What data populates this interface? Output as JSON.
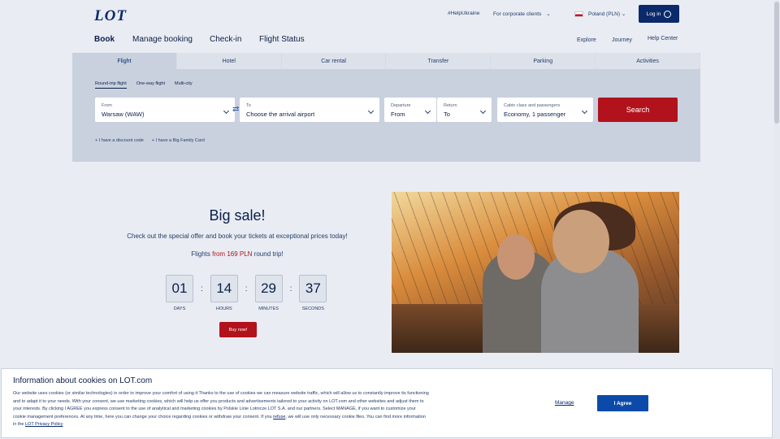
{
  "header": {
    "logo": "LOT",
    "help_ukraine": "#HelpUkraine",
    "corporate": "For corporate clients",
    "country": "Poland (PLN)",
    "login": "Log in"
  },
  "nav": {
    "book": "Book",
    "manage": "Manage booking",
    "checkin": "Check-in",
    "status": "Flight Status",
    "explore": "Explore",
    "journey": "Journey",
    "help": "Help Center"
  },
  "tabs": [
    "Flight",
    "Hotel",
    "Car rental",
    "Transfer",
    "Parking",
    "Activities"
  ],
  "trip_types": [
    "Round-trip flight",
    "One-way flight",
    "Multi-city"
  ],
  "form": {
    "from_label": "From",
    "from_value": "Warsaw (WAW)",
    "to_label": "To",
    "to_value": "Choose the arrival airport",
    "departure_label": "Departure",
    "departure_value": "From",
    "return_label": "Return",
    "return_value": "To",
    "cabin_label": "Cabin class and passengers",
    "cabin_value": "Economy, 1 passenger",
    "search": "Search",
    "discount": "I have a discount code",
    "family": "I have a Big Family Card"
  },
  "promo": {
    "title": "Big sale!",
    "subtitle": "Check out the special offer and book your tickets at exceptional prices today!",
    "flights_prefix": "Flights ",
    "flights_price": "from 169 PLN",
    "flights_suffix": " round trip!",
    "countdown": [
      {
        "value": "01",
        "unit": "DAYS"
      },
      {
        "value": "14",
        "unit": "HOURS"
      },
      {
        "value": "29",
        "unit": "MINUTES"
      },
      {
        "value": "37",
        "unit": "SECONDS"
      }
    ],
    "buy": "Buy now!"
  },
  "cookie": {
    "title": "Information about cookies on LOT.com",
    "text": "Our website uses cookies (or similar technologies) in order to improve your comfort of using it Thanks to the use of cookies we can measure website traffic, which will allow us to constantly improve its functioning and to adapt it to your needs. With your consent, we use marketing cookies, which will help us offer you products and advertisements tailored to your activity on LOT.com and other websites and adjust them to your interests. By clicking I AGREE you express consent to the use of analytical and marketing cookies by Polskie Linie Lotnicze LOT S.A. and our partners. Select MANAGE, if you want to customize your cookie management preferences. At any time, here you can change your choice regarding cookies or withdraw your consent. If you ",
    "refuse": "refuse",
    "text2": ", we will use only necessary cookie files. You can find more information in the ",
    "privacy": "LOT Privacy Policy",
    "manage": "Manage",
    "agree": "I Agree"
  },
  "colors": {
    "brand_navy": "#0b2a6b",
    "accent_red": "#b2121c",
    "agree_blue": "#0b4aa8"
  }
}
